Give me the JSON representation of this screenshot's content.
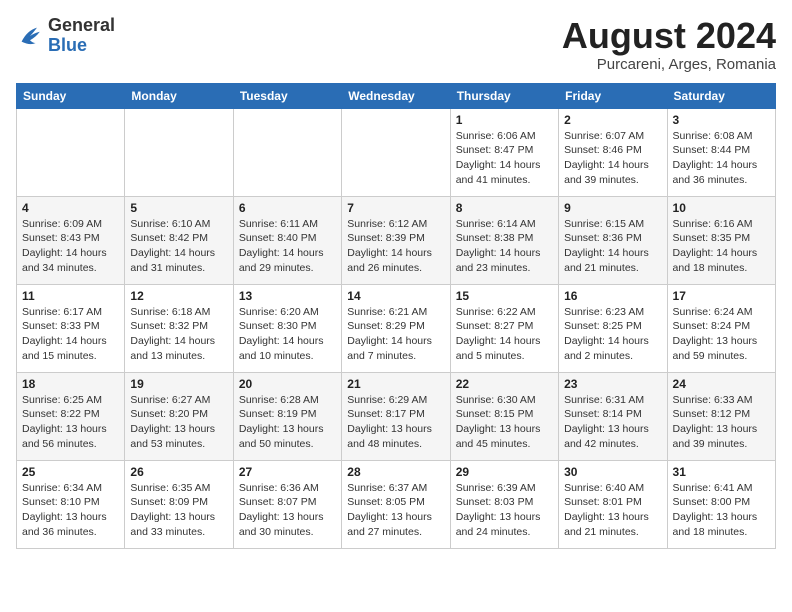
{
  "header": {
    "logo": {
      "general": "General",
      "blue": "Blue"
    },
    "title": "August 2024",
    "location": "Purcareni, Arges, Romania"
  },
  "weekdays": [
    "Sunday",
    "Monday",
    "Tuesday",
    "Wednesday",
    "Thursday",
    "Friday",
    "Saturday"
  ],
  "weeks": [
    [
      null,
      null,
      null,
      null,
      {
        "day": "1",
        "sunrise": "6:06 AM",
        "sunset": "8:47 PM",
        "daylight": "14 hours and 41 minutes."
      },
      {
        "day": "2",
        "sunrise": "6:07 AM",
        "sunset": "8:46 PM",
        "daylight": "14 hours and 39 minutes."
      },
      {
        "day": "3",
        "sunrise": "6:08 AM",
        "sunset": "8:44 PM",
        "daylight": "14 hours and 36 minutes."
      }
    ],
    [
      {
        "day": "4",
        "sunrise": "6:09 AM",
        "sunset": "8:43 PM",
        "daylight": "14 hours and 34 minutes."
      },
      {
        "day": "5",
        "sunrise": "6:10 AM",
        "sunset": "8:42 PM",
        "daylight": "14 hours and 31 minutes."
      },
      {
        "day": "6",
        "sunrise": "6:11 AM",
        "sunset": "8:40 PM",
        "daylight": "14 hours and 29 minutes."
      },
      {
        "day": "7",
        "sunrise": "6:12 AM",
        "sunset": "8:39 PM",
        "daylight": "14 hours and 26 minutes."
      },
      {
        "day": "8",
        "sunrise": "6:14 AM",
        "sunset": "8:38 PM",
        "daylight": "14 hours and 23 minutes."
      },
      {
        "day": "9",
        "sunrise": "6:15 AM",
        "sunset": "8:36 PM",
        "daylight": "14 hours and 21 minutes."
      },
      {
        "day": "10",
        "sunrise": "6:16 AM",
        "sunset": "8:35 PM",
        "daylight": "14 hours and 18 minutes."
      }
    ],
    [
      {
        "day": "11",
        "sunrise": "6:17 AM",
        "sunset": "8:33 PM",
        "daylight": "14 hours and 15 minutes."
      },
      {
        "day": "12",
        "sunrise": "6:18 AM",
        "sunset": "8:32 PM",
        "daylight": "14 hours and 13 minutes."
      },
      {
        "day": "13",
        "sunrise": "6:20 AM",
        "sunset": "8:30 PM",
        "daylight": "14 hours and 10 minutes."
      },
      {
        "day": "14",
        "sunrise": "6:21 AM",
        "sunset": "8:29 PM",
        "daylight": "14 hours and 7 minutes."
      },
      {
        "day": "15",
        "sunrise": "6:22 AM",
        "sunset": "8:27 PM",
        "daylight": "14 hours and 5 minutes."
      },
      {
        "day": "16",
        "sunrise": "6:23 AM",
        "sunset": "8:25 PM",
        "daylight": "14 hours and 2 minutes."
      },
      {
        "day": "17",
        "sunrise": "6:24 AM",
        "sunset": "8:24 PM",
        "daylight": "13 hours and 59 minutes."
      }
    ],
    [
      {
        "day": "18",
        "sunrise": "6:25 AM",
        "sunset": "8:22 PM",
        "daylight": "13 hours and 56 minutes."
      },
      {
        "day": "19",
        "sunrise": "6:27 AM",
        "sunset": "8:20 PM",
        "daylight": "13 hours and 53 minutes."
      },
      {
        "day": "20",
        "sunrise": "6:28 AM",
        "sunset": "8:19 PM",
        "daylight": "13 hours and 50 minutes."
      },
      {
        "day": "21",
        "sunrise": "6:29 AM",
        "sunset": "8:17 PM",
        "daylight": "13 hours and 48 minutes."
      },
      {
        "day": "22",
        "sunrise": "6:30 AM",
        "sunset": "8:15 PM",
        "daylight": "13 hours and 45 minutes."
      },
      {
        "day": "23",
        "sunrise": "6:31 AM",
        "sunset": "8:14 PM",
        "daylight": "13 hours and 42 minutes."
      },
      {
        "day": "24",
        "sunrise": "6:33 AM",
        "sunset": "8:12 PM",
        "daylight": "13 hours and 39 minutes."
      }
    ],
    [
      {
        "day": "25",
        "sunrise": "6:34 AM",
        "sunset": "8:10 PM",
        "daylight": "13 hours and 36 minutes."
      },
      {
        "day": "26",
        "sunrise": "6:35 AM",
        "sunset": "8:09 PM",
        "daylight": "13 hours and 33 minutes."
      },
      {
        "day": "27",
        "sunrise": "6:36 AM",
        "sunset": "8:07 PM",
        "daylight": "13 hours and 30 minutes."
      },
      {
        "day": "28",
        "sunrise": "6:37 AM",
        "sunset": "8:05 PM",
        "daylight": "13 hours and 27 minutes."
      },
      {
        "day": "29",
        "sunrise": "6:39 AM",
        "sunset": "8:03 PM",
        "daylight": "13 hours and 24 minutes."
      },
      {
        "day": "30",
        "sunrise": "6:40 AM",
        "sunset": "8:01 PM",
        "daylight": "13 hours and 21 minutes."
      },
      {
        "day": "31",
        "sunrise": "6:41 AM",
        "sunset": "8:00 PM",
        "daylight": "13 hours and 18 minutes."
      }
    ]
  ]
}
